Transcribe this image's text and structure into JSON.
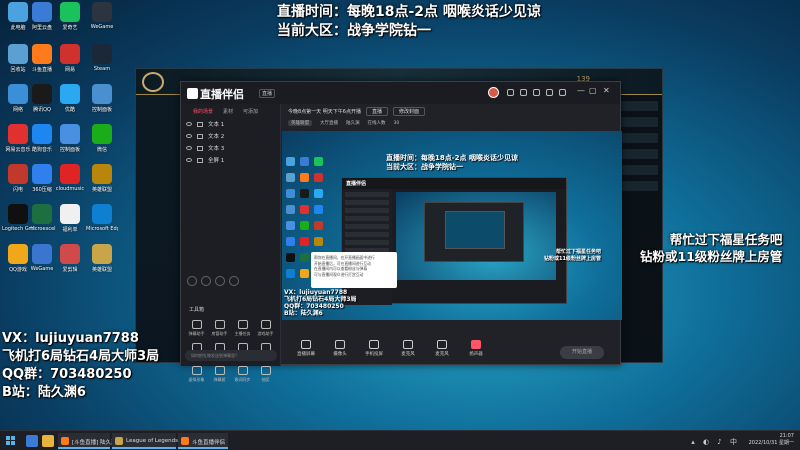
{
  "overlay_top": {
    "line1": "直播时间：每晚18点-2点   咽喉炎话少见谅",
    "line2": "当前大区：战争学院钻一"
  },
  "overlay_left": {
    "vx": "VX：lujiuyuan7788",
    "rank": "飞机打6局钻石4局大师3局",
    "qq": "QQ群：703480250",
    "bili": "B站：陆久渊6"
  },
  "overlay_right": {
    "line1": "帮忙过下福星任务吧",
    "line2": "钻粉或11级粉丝牌上房管"
  },
  "desktop_icons": [
    {
      "label": "此电脑",
      "color": "#4aa3df"
    },
    {
      "label": "阿里云盘",
      "color": "#3a7bd5"
    },
    {
      "label": "爱奇艺",
      "color": "#19c25a"
    },
    {
      "label": "WeGame",
      "color": "#2c3440"
    },
    {
      "label": "回收站",
      "color": "#5aa0d0"
    },
    {
      "label": "斗鱼直播",
      "color": "#ff7a1a"
    },
    {
      "label": "网易",
      "color": "#d0312d"
    },
    {
      "label": "Steam",
      "color": "#1b2838"
    },
    {
      "label": "网络",
      "color": "#3b8fd6"
    },
    {
      "label": "腾讯QQ",
      "color": "#1a1a1a"
    },
    {
      "label": "优酷",
      "color": "#2aa8f2"
    },
    {
      "label": "控制面板",
      "color": "#4a8fd0"
    },
    {
      "label": "网易云音乐",
      "color": "#e03030"
    },
    {
      "label": "酷狗音乐",
      "color": "#1e86f0"
    },
    {
      "label": "控制面板",
      "color": "#4a90e2"
    },
    {
      "label": "微信",
      "color": "#1aad19"
    },
    {
      "label": "闪电",
      "color": "#c0392b"
    },
    {
      "label": "360压缩",
      "color": "#2f80ed"
    },
    {
      "label": "cloudmusic",
      "color": "#e02424"
    },
    {
      "label": "英雄联盟",
      "color": "#b8860b"
    },
    {
      "label": "Logitech G HUB",
      "color": "#101010"
    },
    {
      "label": "microexcel",
      "color": "#1d6f42"
    },
    {
      "label": "福利单",
      "color": "#f0f0f0"
    },
    {
      "label": "Microsoft Edge",
      "color": "#0f7fd1"
    },
    {
      "label": "QQ游戏",
      "color": "#f0a81a"
    },
    {
      "label": "WeGame",
      "color": "#3a75d0"
    },
    {
      "label": "爱剪辑",
      "color": "#d04a4a"
    },
    {
      "label": "英雄联盟",
      "color": "#c9a54a"
    }
  ],
  "game_client": {
    "stat": "139"
  },
  "app": {
    "logo": "直播伴侣",
    "badge": "直播",
    "left_tabs": [
      "我的场景",
      "素材",
      "可添加"
    ],
    "scenes": [
      "文本 1",
      "文本 2",
      "文本 3",
      "全屏 1"
    ],
    "tools_title": "工具箱",
    "tools": [
      "弹幕助手",
      "房管助手",
      "主播任务",
      "游戏助手",
      "视频连麦",
      "多人连麦",
      "录屏播",
      "跨房PK",
      "虚拟形象",
      "弹幕姬",
      "歌词同步",
      "抽奖"
    ],
    "search_placeholder": "如何把礼物发送到弹幕里？",
    "info_title": "今晚8点第一天 明天下午6点开播",
    "info_pill": "直播",
    "info_button": "修改封面",
    "info_sub": [
      "英雄联盟",
      "大厅直播",
      "陆久渊",
      "在线人数",
      "30"
    ],
    "preview_text1": "直播时间：每晚18点-2点   咽喉炎话少见谅",
    "preview_text2": "当前大区：战争学院钻一",
    "preview_left": [
      "VX：lujiuyuan7788",
      "飞机打6局钻石4局大师3局",
      "QQ群：703480250",
      "B站：陆久渊6"
    ],
    "preview_right": [
      "帮忙过下福星任务吧",
      "钻粉或11级粉丝牌上房管"
    ],
    "nested_logo": "直播伴侣",
    "tooltip_lines": [
      "帮你在直播间，在开直播画面中进行",
      "开始直播后，可在直播间进行互动",
      "在直播间内可以查看粉丝与弹幕",
      "可与直播间观众进行打赏互动"
    ],
    "bottom_buttons": [
      "直播屏幕",
      "摄像头",
      "手机投屏",
      "麦克风",
      "麦克风",
      "扬声器"
    ],
    "go_live": "开始直播"
  },
  "taskbar": {
    "tasks": [
      {
        "label": "[斗鱼直播] 陆久渊6",
        "color": "#ff7a1a"
      },
      {
        "label": "League of Legends",
        "color": "#c9a54a"
      },
      {
        "label": "斗鱼直播伴侣",
        "color": "#ff7a1a"
      }
    ],
    "time": "21:07",
    "date": "2022/10/31 星期一"
  }
}
